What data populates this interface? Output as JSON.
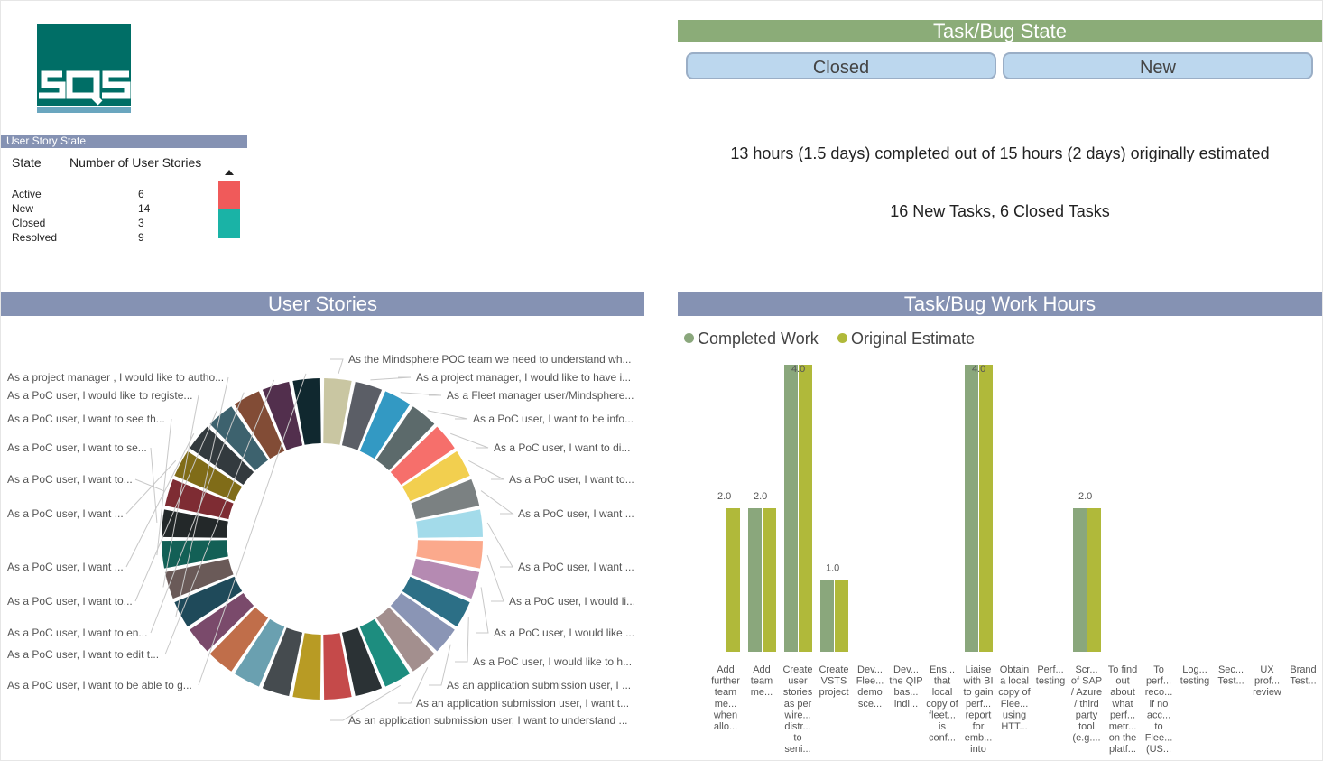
{
  "logo": {
    "text": "SQS"
  },
  "user_story_state": {
    "header": "User Story State",
    "col_state": "State",
    "col_count": "Number of User Stories",
    "rows": [
      {
        "state": "Active",
        "count": "6",
        "color": "#f05a5a"
      },
      {
        "state": "New",
        "count": "14",
        "color": "#f05a5a"
      },
      {
        "state": "Closed",
        "count": "3",
        "color": "#1ab3a6"
      },
      {
        "state": "Resolved",
        "count": "9",
        "color": "#1ab3a6"
      }
    ]
  },
  "task_bug_state": {
    "title": "Task/Bug State",
    "buttons": [
      "Closed",
      "New"
    ]
  },
  "summary": {
    "hours": "13 hours (1.5 days) completed out of 15 hours (2 days) originally estimated",
    "tasks": "16 New Tasks, 6 Closed Tasks"
  },
  "user_stories": {
    "title": "User Stories",
    "labels_right": [
      "As the Mindsphere POC team we need to understand wh...",
      "As a project manager, I would like to have i...",
      "As a Fleet manager user/Mindsphere...",
      "As a PoC user, I want to be info...",
      "As a PoC user, I want to di...",
      "As a PoC user, I want to...",
      "As a PoC user, I want ...",
      "As a PoC user, I want ...",
      "As a PoC user, I would li...",
      "As a PoC user, I would like ...",
      "As a PoC user, I would like to h...",
      "As an application submission user, I ...",
      "As an application submission user, I want t...",
      "As an application submission user, I want to understand ..."
    ],
    "labels_left": [
      "As a project manager , I would like to autho...",
      "As a PoC user, I would like to registe...",
      "As a PoC user, I want to see th...",
      "As a PoC user, I want to se...",
      "As a PoC user, I want to...",
      "As a PoC user, I want ...",
      "As a PoC user, I want ...",
      "As a PoC user, I want to...",
      "As a PoC user, I want to en...",
      "As a PoC user, I want to edit t...",
      "As a PoC user, I want to be able to g..."
    ],
    "slice_colors": [
      "#c9c6a2",
      "#5b5e66",
      "#3399c3",
      "#5c6a6b",
      "#f66f6b",
      "#f2cf4f",
      "#7b8182",
      "#a3dbea",
      "#fba98c",
      "#b58ab2",
      "#2c6f86",
      "#8a95b5",
      "#a38f8e",
      "#1d8d7f",
      "#2b3235",
      "#c54a4a",
      "#b89b24",
      "#454b4f",
      "#6aa0b0",
      "#c06e4a",
      "#7a4a6b",
      "#1f4a5a",
      "#6a5a58",
      "#136056",
      "#232829",
      "#7e2c33",
      "#806c18",
      "#333a3e",
      "#3d626e",
      "#824c36",
      "#522f4d",
      "#10282f"
    ]
  },
  "work_hours": {
    "title": "Task/Bug Work Hours",
    "legend": [
      {
        "name": "Completed Work",
        "color": "#8aa77c"
      },
      {
        "name": "Original Estimate",
        "color": "#b0b93a"
      }
    ]
  },
  "chart_data": {
    "type": "bar",
    "categories": [
      "Add further team me... when allo...",
      "Add team me...",
      "Create user stories as per wire... distr... to seni...",
      "Create VSTS project",
      "Dev... Flee... demo sce...",
      "Dev... the QIP bas... indi...",
      "Ens... that local copy of fleet... is conf...",
      "Liaise with BI to gain perf... report for emb... into ...",
      "Obtain a local copy of Flee... using HTT...",
      "Perf... testing",
      "Scr... of SAP / Azure / third party tool (e.g....",
      "To find out about what perf... metr... on the platf...",
      "To perf... reco... if no acc... to Flee... (US...",
      "Log... testing",
      "Sec... Test...",
      "UX prof... review",
      "Brand Test..."
    ],
    "series": [
      {
        "name": "Completed Work",
        "values": [
          null,
          2.0,
          4.0,
          1.0,
          null,
          null,
          null,
          4.0,
          null,
          null,
          2.0,
          null,
          null,
          null,
          null,
          null,
          null
        ]
      },
      {
        "name": "Original Estimate",
        "values": [
          2.0,
          2.0,
          4.0,
          1.0,
          null,
          null,
          null,
          4.0,
          null,
          null,
          2.0,
          null,
          null,
          null,
          null,
          null,
          null
        ]
      }
    ],
    "data_labels": [
      "2.0",
      "2.0",
      "4.0",
      "1.0",
      "",
      "",
      "",
      "4.0",
      "",
      "",
      "2.0",
      "",
      "",
      "",
      "",
      "",
      ""
    ],
    "ylim": [
      0,
      4.0
    ],
    "legend": "top-left",
    "grid": false
  }
}
